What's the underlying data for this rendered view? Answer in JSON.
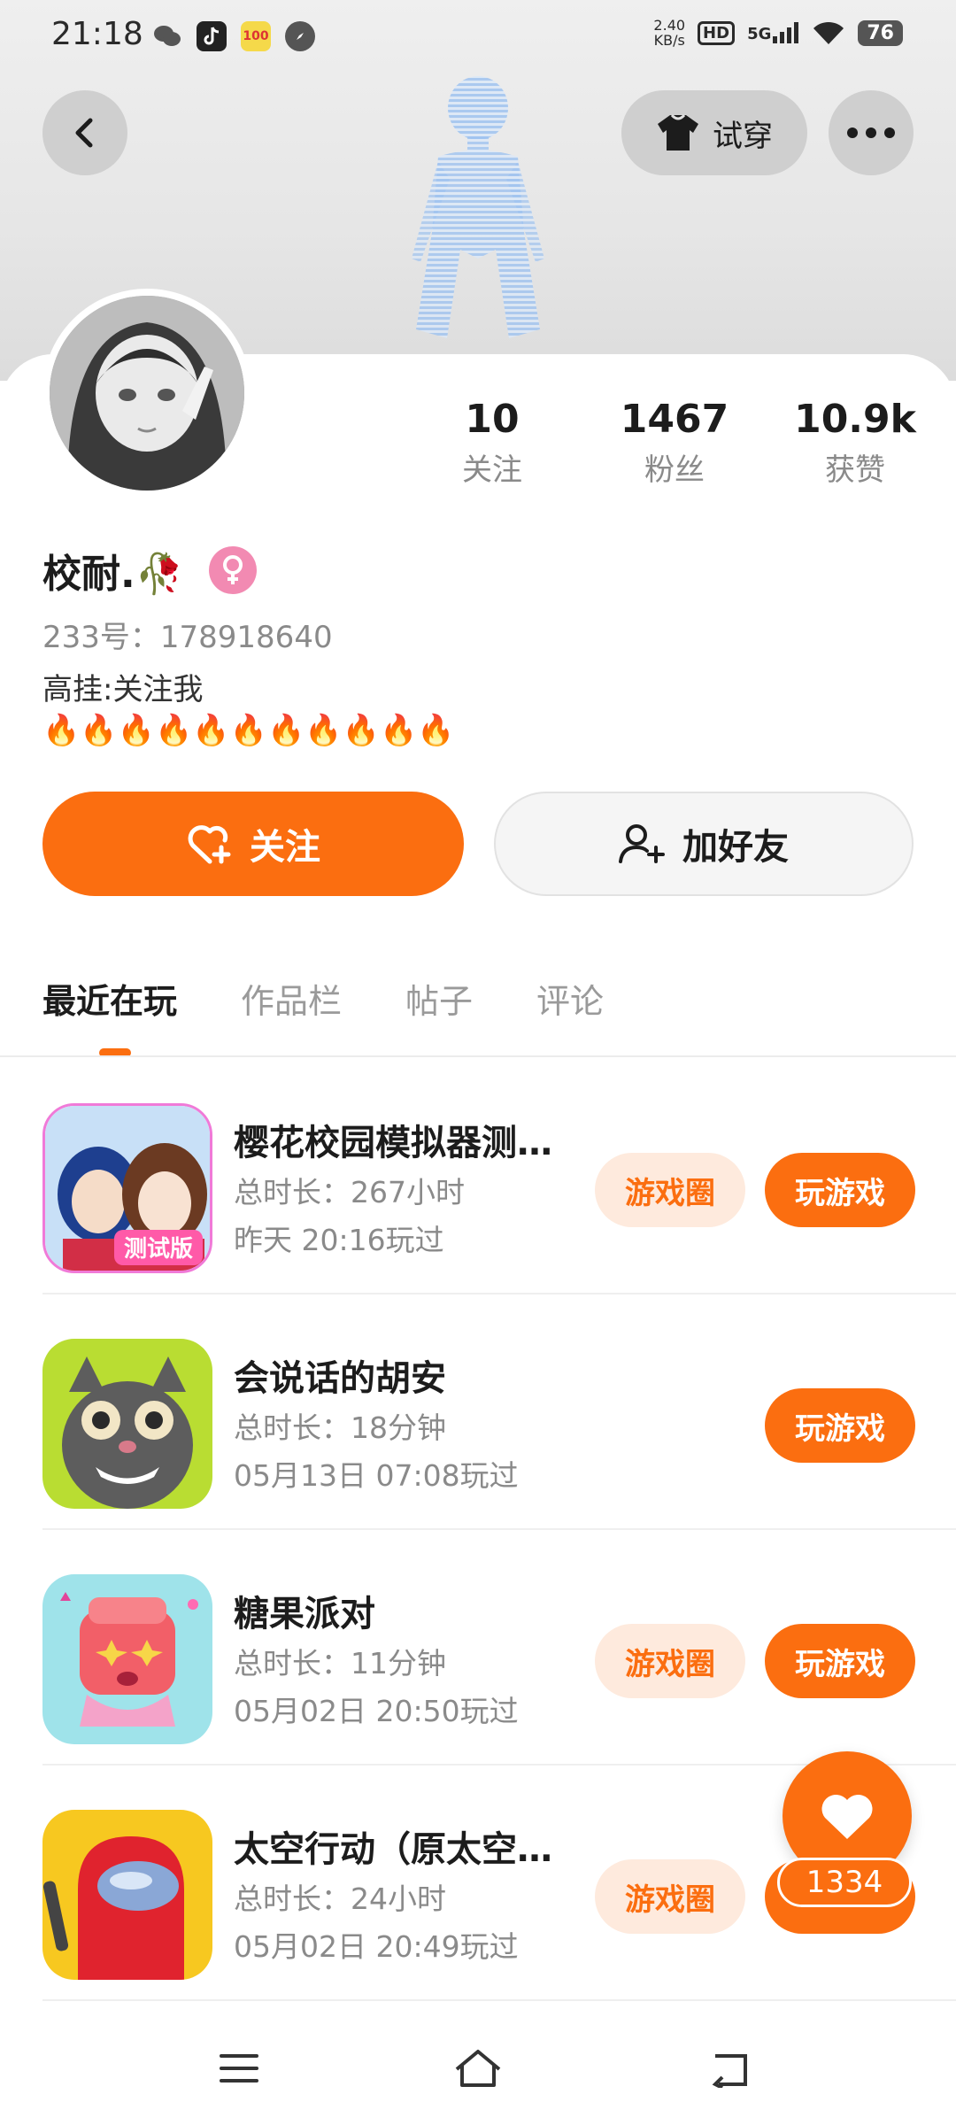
{
  "status_bar": {
    "time": "21:18",
    "net_speed_value": "2.40",
    "net_speed_unit": "KB/s",
    "hd": "HD",
    "signal": "5G",
    "battery": "76"
  },
  "header": {
    "try_on_label": "试穿"
  },
  "profile": {
    "name": "校耐.🥀",
    "uid": "233号：178918640",
    "bio_line1": "高挂:关注我",
    "bio_line2": "🔥🔥🔥🔥🔥🔥🔥🔥🔥🔥🔥"
  },
  "stats": [
    {
      "num": "10",
      "label": "关注"
    },
    {
      "num": "1467",
      "label": "粉丝"
    },
    {
      "num": "10.9k",
      "label": "获赞"
    }
  ],
  "actions": {
    "follow": "关注",
    "add_friend": "加好友"
  },
  "tabs": [
    "最近在玩",
    "作品栏",
    "帖子",
    "评论"
  ],
  "games": [
    {
      "title": "樱花校园模拟器测试版",
      "duration": "总时长：267小时",
      "last": "昨天 20:16玩过",
      "circle": "游戏圈",
      "play": "玩游戏"
    },
    {
      "title": "会说话的胡安",
      "duration": "总时长：18分钟",
      "last": "05月13日 07:08玩过",
      "circle": "",
      "play": "玩游戏"
    },
    {
      "title": "糖果派对",
      "duration": "总时长：11分钟",
      "last": "05月02日 20:50玩过",
      "circle": "游戏圈",
      "play": "玩游戏"
    },
    {
      "title": "太空行动（原太空杀）",
      "duration": "总时长：24小时",
      "last": "05月02日 20:49玩过",
      "circle": "游戏圈",
      "play": "玩游戏"
    }
  ],
  "fab": {
    "count": "1334"
  },
  "colors": {
    "accent": "#fb6e10",
    "accent_light": "#feeadd",
    "gender_pink": "#f28ab2"
  }
}
